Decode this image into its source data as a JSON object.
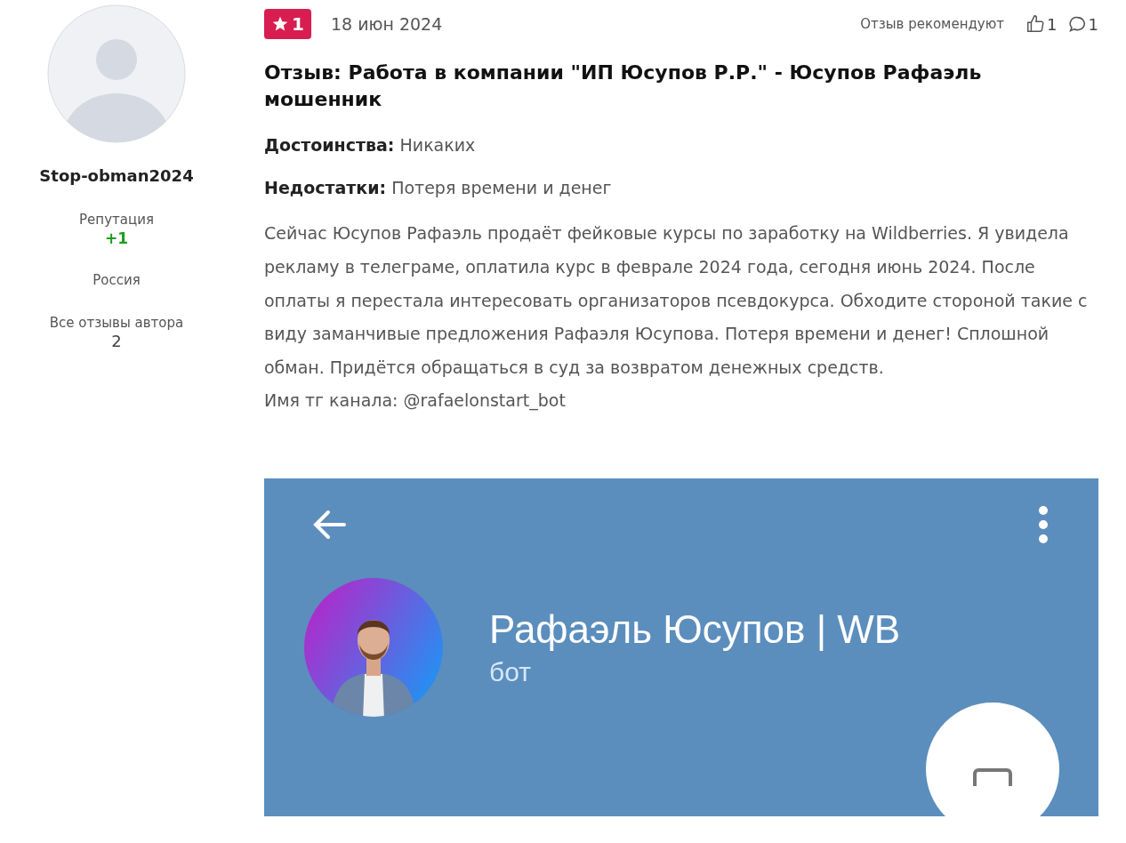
{
  "author": {
    "name": "Stop-obman2024",
    "reputation_label": "Репутация",
    "reputation": "+1",
    "country": "Россия",
    "reviews_label": "Все отзывы автора",
    "reviews_count": "2"
  },
  "review": {
    "rating": "1",
    "date": "18 июн 2024",
    "recommend_label": "Отзыв рекомендуют",
    "likes": "1",
    "comments": "1",
    "title": "Отзыв: Работа в компании \"ИП Юсупов Р.Р.\" - Юсупов Рафаэль мошенник",
    "fields": [
      {
        "label": "Достоинства:",
        "value": "Никаких"
      },
      {
        "label": "Недостатки:",
        "value": "Потеря времени и денег"
      }
    ],
    "body": [
      "Сейчас Юсупов Рафаэль продаёт фейковые курсы по заработку на Wildberries. Я увидела рекламу в телеграме, оплатила курс в феврале 2024 года, сегодня июнь 2024. После оплаты я перестала интересовать организаторов псевдокурса. Обходите стороной такие с виду заманчивые предложения Рафаэля Юсупова. Потеря времени и денег! Сплошной обман. Придётся обращаться в суд за возвратом денежных средств.",
      "Имя тг канала: @rafaelonstart_bot"
    ]
  },
  "screenshot": {
    "name": "Рафаэль Юсупов | WB",
    "subtitle": "бот"
  }
}
